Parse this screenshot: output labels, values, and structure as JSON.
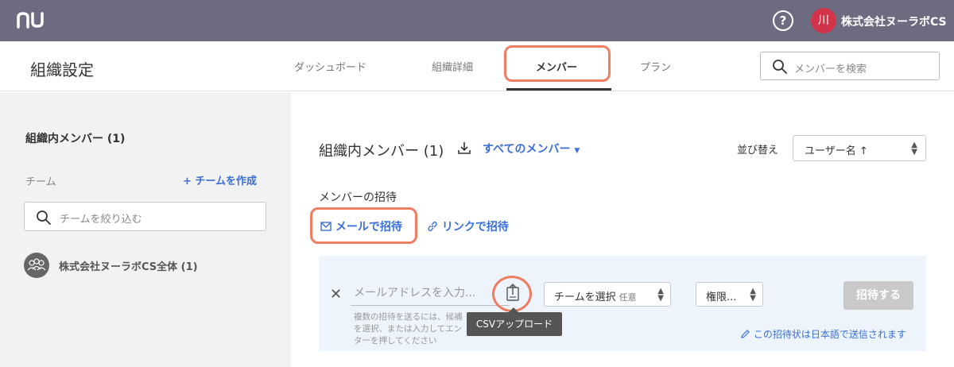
{
  "topbar": {
    "logo": "nu",
    "help_label": "?",
    "avatar_initial": "川",
    "org_name": "株式会社ヌーラボCS"
  },
  "header": {
    "title": "組織設定",
    "tabs": [
      {
        "label": "ダッシュボード",
        "active": false
      },
      {
        "label": "組織詳細",
        "active": false
      },
      {
        "label": "メンバー",
        "active": true
      },
      {
        "label": "プラン",
        "active": false
      }
    ],
    "search_placeholder": "メンバーを検索"
  },
  "sidebar": {
    "heading": "組織内メンバー (1)",
    "team_label": "チーム",
    "create_team": "チームを作成",
    "filter_placeholder": "チームを絞り込む",
    "teams": [
      {
        "name": "株式会社ヌーラボCS全体 (1)"
      }
    ]
  },
  "main": {
    "heading": "組織内メンバー (1)",
    "filter_label": "すべてのメンバー",
    "sort_label": "並び替え",
    "sort_value": "ユーザー名 ↑",
    "invite_title": "メンバーの招待",
    "invite_mail": "メールで招待",
    "invite_link": "リンクで招待",
    "form": {
      "email_placeholder": "メールアドレスを入力...",
      "help_text": "複数の招待を送るには、候補を選択、または入力してエンターを押してください",
      "team_select": "チームを選択",
      "team_optional": "任意",
      "permission_select": "権限...",
      "submit": "招待する",
      "language_note": "この招待状は日本語で送信されます"
    },
    "tooltip": "CSVアップロード"
  },
  "colors": {
    "topbar": "#6d6b80",
    "accent": "#3a6fd8",
    "highlight": "#ee7d61",
    "avatar": "#d0334a"
  }
}
